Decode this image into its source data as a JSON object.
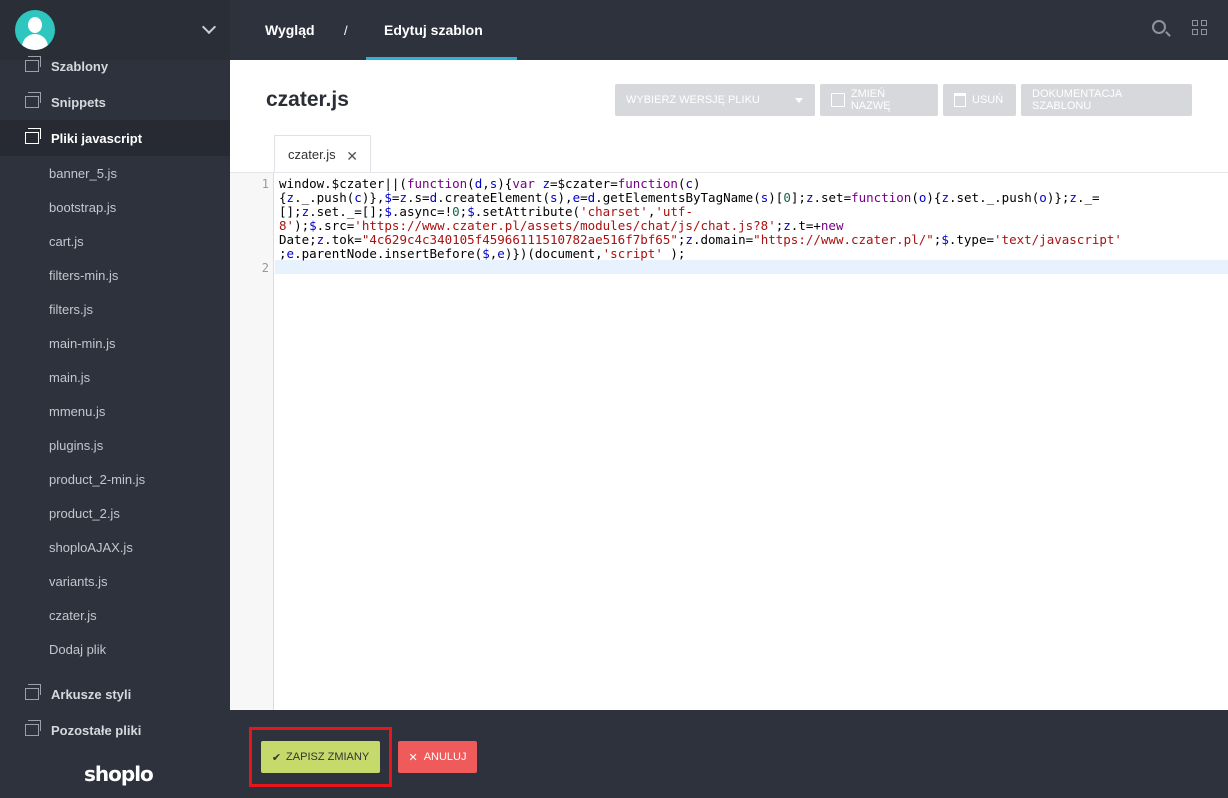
{
  "sidebar": {
    "sections_top": [
      {
        "label": "Szablony",
        "icon": "layers-icon"
      },
      {
        "label": "Snippets",
        "icon": "layers-icon"
      },
      {
        "label": "Pliki javascript",
        "icon": "layers-icon",
        "active": true
      }
    ],
    "files": [
      "banner_5.js",
      "bootstrap.js",
      "cart.js",
      "filters-min.js",
      "filters.js",
      "main-min.js",
      "main.js",
      "mmenu.js",
      "plugins.js",
      "product_2-min.js",
      "product_2.js",
      "shoploAJAX.js",
      "variants.js",
      "czater.js",
      "Dodaj plik"
    ],
    "sections_bottom": [
      {
        "label": "Arkusze styli",
        "icon": "layers-icon"
      },
      {
        "label": "Pozostałe pliki",
        "icon": "layers-icon"
      }
    ],
    "logo": "shoplo"
  },
  "topbar": {
    "breadcrumb_root": "Wygląd",
    "separator": "/",
    "breadcrumb_current": "Edytuj szablon"
  },
  "page": {
    "title": "czater.js",
    "btn_version": "Wybierz wersję pliku",
    "btn_rename": "Zmień nazwę",
    "btn_delete": "Usuń",
    "btn_docs": "Dokumentacja szablonu"
  },
  "editor": {
    "tab_label": "czater.js",
    "line_numbers": [
      "1",
      "2"
    ]
  },
  "footer": {
    "save_label": "Zapisz zmiany",
    "cancel_label": "Anuluj"
  },
  "colors": {
    "accent": "#2fb0d8",
    "save": "#c6d96b",
    "cancel": "#ef5a5a",
    "highlight": "#e8151c"
  }
}
